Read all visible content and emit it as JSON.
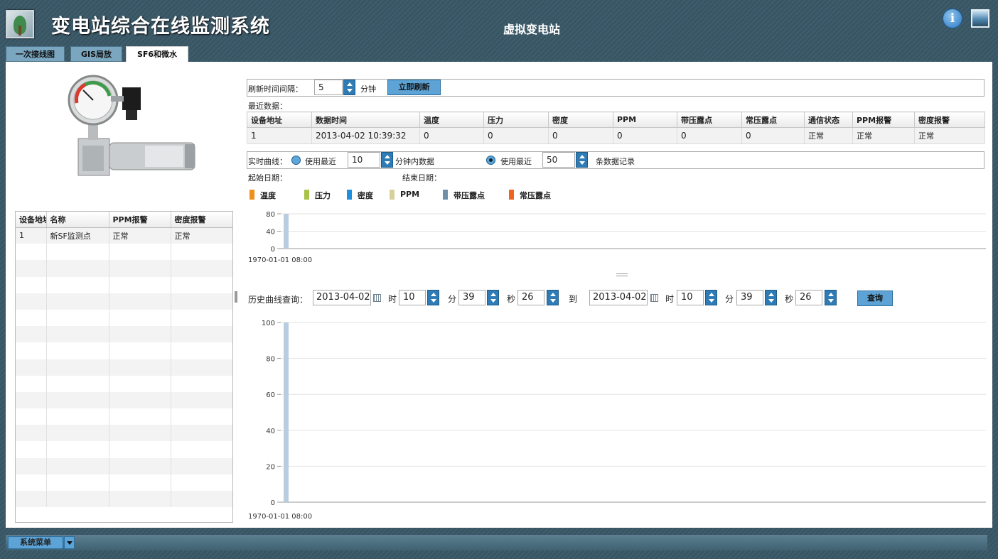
{
  "header": {
    "app_title": "变电站综合在线监测系统",
    "station_name": "虚拟变电站"
  },
  "icons": {
    "logo": "tree-logo-icon",
    "info": "info-icon",
    "screen": "screen-icon"
  },
  "tabs": [
    {
      "label": "一次接线图",
      "active": false
    },
    {
      "label": "GIS局放",
      "active": false
    },
    {
      "label": "SF6和微水",
      "active": true
    }
  ],
  "left_table": {
    "headers": [
      "设备地址",
      "名称",
      "PPM报警",
      "密度报警"
    ],
    "rows": [
      [
        "1",
        "新SF监测点",
        "正常",
        "正常"
      ]
    ]
  },
  "refresh": {
    "interval_label": "刷新时间间隔：",
    "interval_value": "5",
    "unit": "分钟",
    "refresh_now": "立即刷新"
  },
  "recent": {
    "label": "最近数据：",
    "headers": [
      "设备地址",
      "数据时间",
      "温度",
      "压力",
      "密度",
      "PPM",
      "带压露点",
      "常压露点",
      "通信状态",
      "PPM报警",
      "密度报警"
    ],
    "rows": [
      [
        "1",
        "2013-04-02 10:39:32",
        "0",
        "0",
        "0",
        "0",
        "0",
        "0",
        "正常",
        "正常",
        "正常"
      ]
    ]
  },
  "realtime": {
    "label": "实时曲线：",
    "opt1_prefix": "使用最近",
    "opt1_value": "10",
    "opt1_suffix": "分钟内数据",
    "opt1_selected": false,
    "opt2_prefix": "使用最近",
    "opt2_value": "50",
    "opt2_suffix": "条数据记录",
    "opt2_selected": true,
    "start_label": "起始日期：",
    "end_label": "结束日期："
  },
  "legend": [
    {
      "name": "温度",
      "color": "#f0901c"
    },
    {
      "name": "压力",
      "color": "#a8c24a"
    },
    {
      "name": "密度",
      "color": "#1f8fe0"
    },
    {
      "name": "PPM",
      "color": "#d8d09a"
    },
    {
      "name": "带压露点",
      "color": "#6f90ad"
    },
    {
      "name": "常压露点",
      "color": "#f0641e"
    }
  ],
  "history": {
    "label": "历史曲线查询：",
    "start_date": "2013-04-02",
    "start_hour": "10",
    "start_min": "39",
    "start_sec": "26",
    "to_label": "到",
    "end_date": "2013-04-02",
    "end_hour": "10",
    "end_min": "39",
    "end_sec": "26",
    "hour_label": "时",
    "min_label": "分",
    "sec_label": "秒",
    "query_button": "查询"
  },
  "chart_data": [
    {
      "type": "bar",
      "ylim": [
        0,
        80
      ],
      "yticks": [
        0,
        40,
        80
      ],
      "categories": [
        "1970-01-01 08:00"
      ],
      "xtick_labels": [
        "1970-01-01 08:00"
      ],
      "grid": true
    },
    {
      "type": "bar",
      "ylim": [
        0,
        100
      ],
      "yticks": [
        0,
        20,
        40,
        60,
        80,
        100
      ],
      "categories": [
        "1970-01-01 08:00"
      ],
      "xtick_labels": [
        "1970-01-01 08:00"
      ],
      "grid": true
    }
  ],
  "bottom": {
    "system_menu": "系统菜单"
  }
}
